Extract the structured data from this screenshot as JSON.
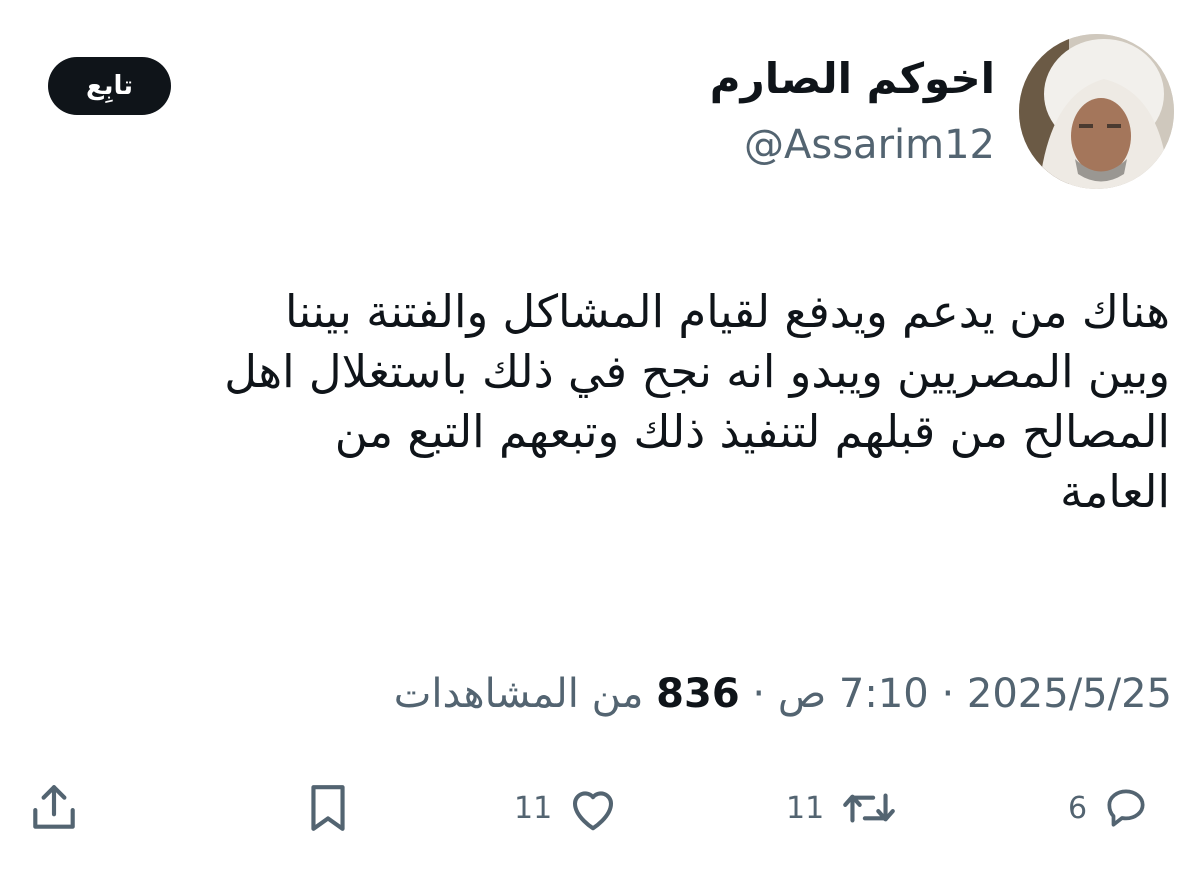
{
  "author": {
    "display_name": "اخوكم الصارم",
    "handle": "@Assarim12"
  },
  "follow_label": "تابِع",
  "tweet": {
    "lines": [
      "هناك من يدعم ويدفع لقيام المشاكل والفتنة بيننا",
      "وبين المصريين ويبدو انه نجح في ذلك باستغلال اهل",
      "المصالح من قبلهم  لتنفيذ ذلك وتبعهم التبع من",
      "العامة"
    ]
  },
  "meta": {
    "date": "2025/5/25",
    "separator": "·",
    "time": "7:10 ص",
    "views_count": "836",
    "views_label": "من المشاهدات"
  },
  "actions": {
    "replies": "6",
    "retweets": "11",
    "likes": "11"
  },
  "colors": {
    "text": "#0f1419",
    "secondary": "#536471",
    "follow_bg": "#0f1419"
  }
}
